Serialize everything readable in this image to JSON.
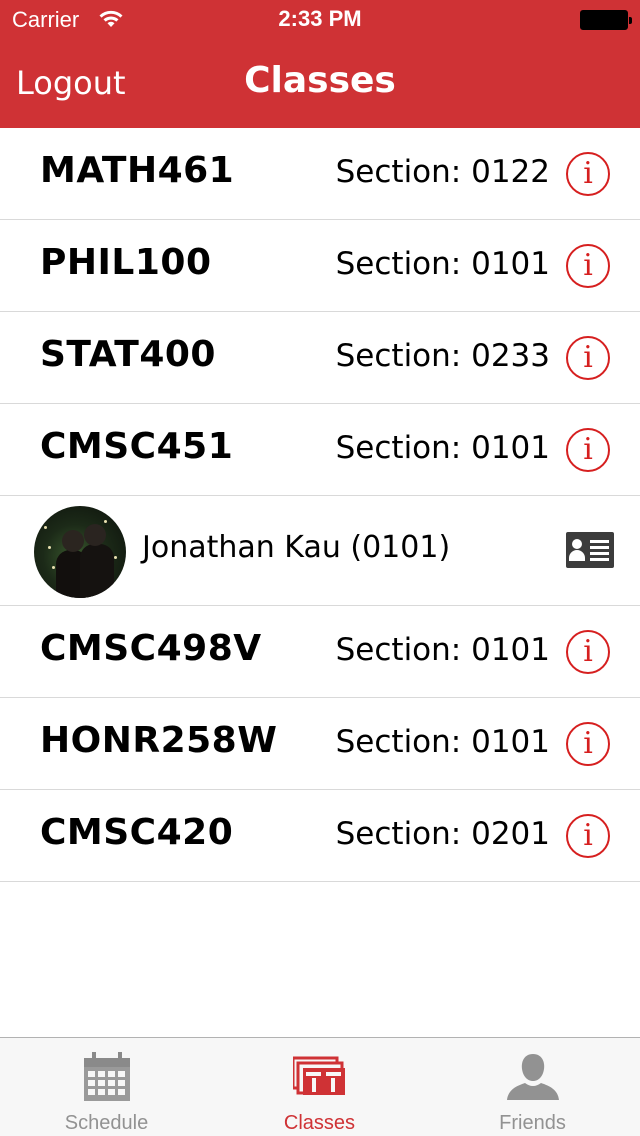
{
  "status_bar": {
    "carrier": "Carrier",
    "time": "2:33 PM"
  },
  "nav": {
    "left_button": "Logout",
    "title": "Classes"
  },
  "classes": [
    {
      "code": "MATH461",
      "section": "Section: 0122"
    },
    {
      "code": "PHIL100",
      "section": "Section: 0101"
    },
    {
      "code": "STAT400",
      "section": "Section: 0233"
    },
    {
      "code": "CMSC451",
      "section": "Section: 0101"
    },
    {
      "code": "CMSC498V",
      "section": "Section: 0101"
    },
    {
      "code": "HONR258W",
      "section": "Section: 0101"
    },
    {
      "code": "CMSC420",
      "section": "Section: 0201"
    }
  ],
  "friend": {
    "name": "Jonathan Kau (0101)"
  },
  "info_glyph": "i",
  "tabs": [
    {
      "label": "Schedule",
      "icon": "calendar-icon",
      "active": false
    },
    {
      "label": "Classes",
      "icon": "classes-stack-icon",
      "active": true
    },
    {
      "label": "Friends",
      "icon": "person-icon",
      "active": false
    }
  ],
  "colors": {
    "brand_red": "#cf3235",
    "info_red": "#d61f1f",
    "tab_inactive": "#929292"
  }
}
